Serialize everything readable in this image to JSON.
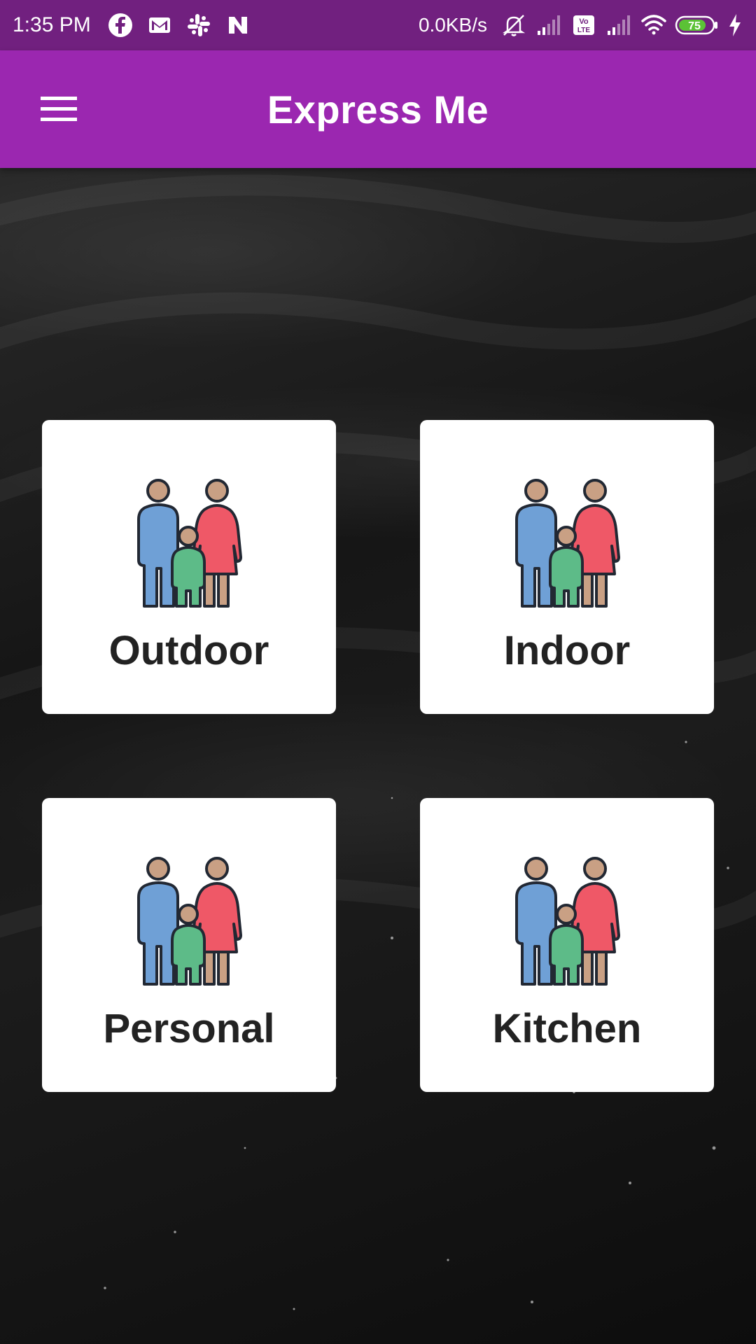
{
  "status_bar": {
    "time": "1:35 PM",
    "network_speed": "0.0KB/s",
    "battery_level": "75",
    "left_icons": [
      "facebook-icon",
      "gmail-icon",
      "slack-icon",
      "n-app-icon"
    ],
    "right_icons": [
      "bell-muted-icon",
      "signal-1-icon",
      "volte-icon",
      "signal-2-icon",
      "wifi-icon",
      "battery-icon",
      "charging-icon"
    ]
  },
  "app_bar": {
    "title": "Express Me",
    "menu_icon": "hamburger-menu-icon"
  },
  "categories": [
    {
      "label": "Outdoor",
      "icon": "family-icon"
    },
    {
      "label": "Indoor",
      "icon": "family-icon"
    },
    {
      "label": "Personal",
      "icon": "family-icon"
    },
    {
      "label": "Kitchen",
      "icon": "family-icon"
    }
  ],
  "colors": {
    "status_bar": "#71207f",
    "app_bar": "#9b27b0",
    "card_bg": "#ffffff",
    "label_text": "#222222",
    "father": "#6fa0d6",
    "mother": "#ef5867",
    "child": "#5dbb88",
    "skin": "#c9a084",
    "outline": "#222833"
  }
}
